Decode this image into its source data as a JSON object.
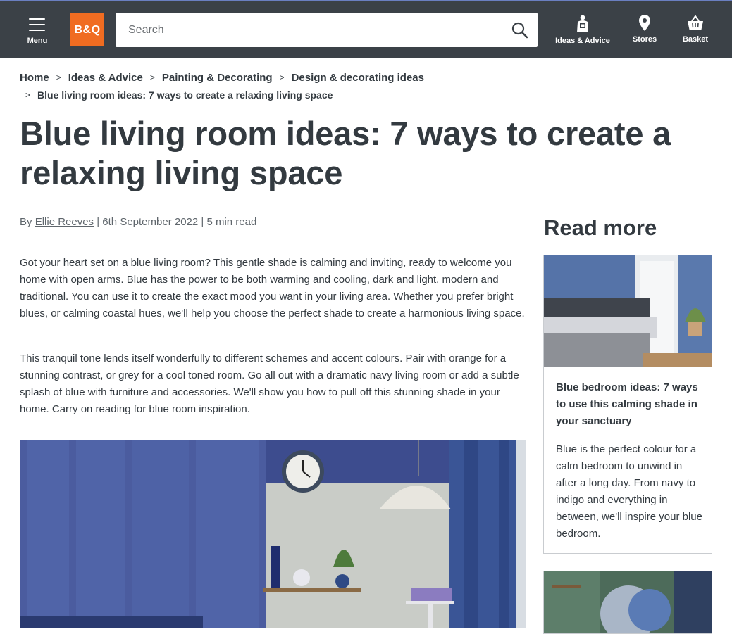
{
  "header": {
    "menu_label": "Menu",
    "logo_text": "B&Q",
    "search_placeholder": "Search",
    "ideas_label": "Ideas & Advice",
    "stores_label": "Stores",
    "basket_label": "Basket",
    "background_color": "#3b4147",
    "logo_color": "#f06c21"
  },
  "breadcrumb": {
    "items": [
      "Home",
      "Ideas & Advice",
      "Painting & Decorating",
      "Design & decorating ideas"
    ],
    "current": "Blue living room ideas: 7 ways to create a relaxing living space"
  },
  "article": {
    "title": "Blue living room ideas: 7 ways to create a relaxing living space",
    "byline_prefix": "By",
    "author": "Ellie Reeves",
    "meta": "| 6th September 2022 | 5 min read",
    "paragraphs": [
      "Got your heart set on a blue living room? This gentle shade is calming and inviting, ready to welcome you home with open arms. Blue has the power to be both warming and cooling, dark and light, modern and traditional. You can use it to create the exact mood you want in your living area. Whether you prefer bright blues, or calming coastal hues, we'll help you choose the perfect shade to create a harmonious living space.",
      "This tranquil tone lends itself wonderfully to different schemes and accent colours. Pair with orange for a stunning contrast, or grey for a cool toned room. Go all out with a dramatic navy living room or add a subtle splash of blue with furniture and accessories. We'll show you how to pull off this stunning shade in your home. Carry on reading for blue room inspiration."
    ]
  },
  "sidebar": {
    "heading": "Read more",
    "cards": [
      {
        "title": "Blue bedroom ideas: 7 ways to use this calming shade in your sanctuary",
        "description": "Blue is the perfect colour for a calm bedroom to unwind in after a long day. From navy to indigo and everything in between, we'll inspire your blue bedroom."
      }
    ]
  }
}
